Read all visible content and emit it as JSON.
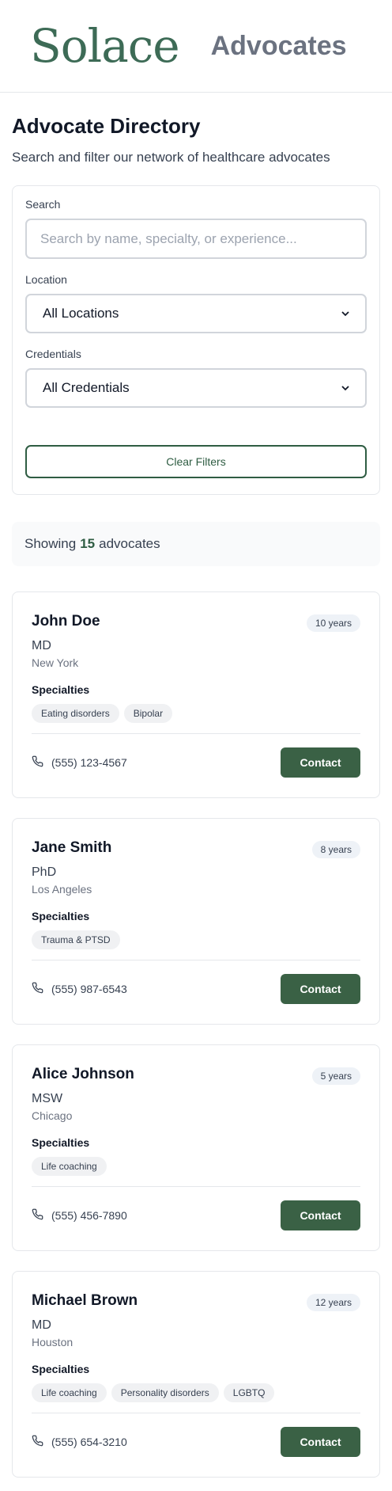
{
  "header": {
    "logo_text": "Solace",
    "title": "Advocates"
  },
  "page": {
    "title": "Advocate Directory",
    "subtitle": "Search and filter our network of healthcare advocates"
  },
  "filters": {
    "search_label": "Search",
    "search_placeholder": "Search by name, specialty, or experience...",
    "search_value": "",
    "location_label": "Location",
    "location_value": "All Locations",
    "credentials_label": "Credentials",
    "credentials_value": "All Credentials",
    "clear_label": "Clear Filters"
  },
  "results": {
    "prefix": "Showing",
    "count": "15",
    "suffix": "advocates"
  },
  "advocates": [
    {
      "name": "John Doe",
      "experience": "10 years",
      "credential": "MD",
      "location": "New York",
      "specialties_label": "Specialties",
      "specialties": [
        "Eating disorders",
        "Bipolar"
      ],
      "phone": "(555) 123-4567",
      "contact_label": "Contact"
    },
    {
      "name": "Jane Smith",
      "experience": "8 years",
      "credential": "PhD",
      "location": "Los Angeles",
      "specialties_label": "Specialties",
      "specialties": [
        "Trauma & PTSD"
      ],
      "phone": "(555) 987-6543",
      "contact_label": "Contact"
    },
    {
      "name": "Alice Johnson",
      "experience": "5 years",
      "credential": "MSW",
      "location": "Chicago",
      "specialties_label": "Specialties",
      "specialties": [
        "Life coaching"
      ],
      "phone": "(555) 456-7890",
      "contact_label": "Contact"
    },
    {
      "name": "Michael Brown",
      "experience": "12 years",
      "credential": "MD",
      "location": "Houston",
      "specialties_label": "Specialties",
      "specialties": [
        "Life coaching",
        "Personality disorders",
        "LGBTQ"
      ],
      "phone": "(555) 654-3210",
      "contact_label": "Contact"
    }
  ],
  "icons": {
    "phone": "phone-icon",
    "select_chevron": "chevron-down-icon"
  },
  "colors": {
    "brand_green": "#3a6145",
    "count_green": "#2f5d43",
    "logo_green": "#3d6b56"
  }
}
